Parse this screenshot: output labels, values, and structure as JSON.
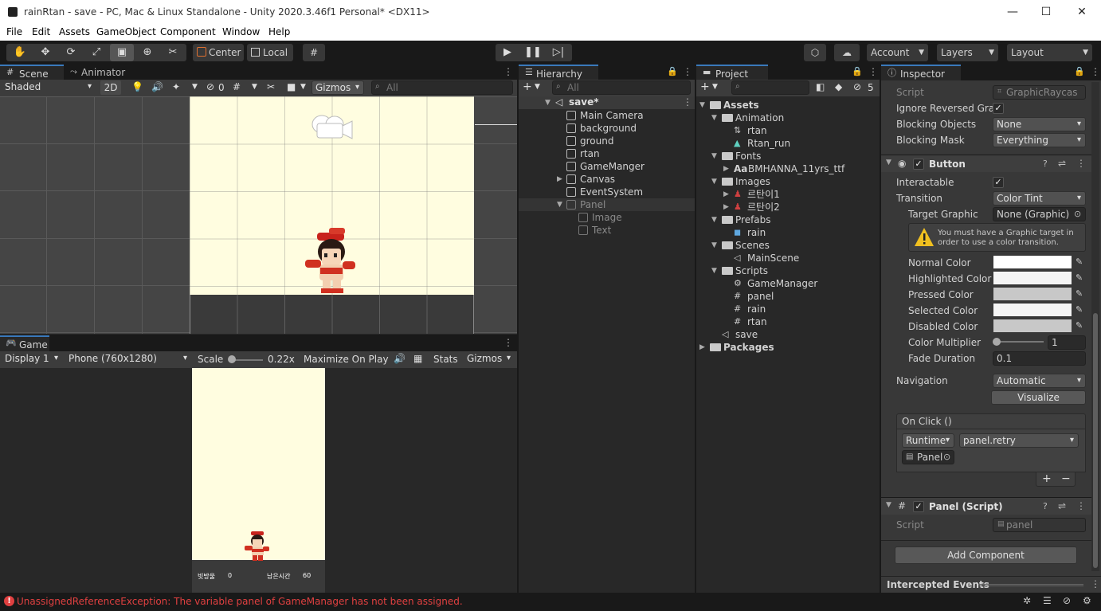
{
  "window": {
    "title": "rainRtan - save - PC, Mac & Linux Standalone - Unity 2020.3.46f1 Personal* <DX11>",
    "minimize": "—",
    "maximize": "☐",
    "close": "✕"
  },
  "menu": [
    "File",
    "Edit",
    "Assets",
    "GameObject",
    "Component",
    "Window",
    "Help"
  ],
  "toolbar": {
    "pivot": "Center",
    "space": "Local",
    "account": "Account",
    "layers": "Layers",
    "layout": "Layout"
  },
  "scene": {
    "tab": "Scene",
    "tab2": "Animator",
    "shading": "Shaded",
    "mode2d": "2D",
    "hidden_count": "0",
    "gizmos": "Gizmos",
    "search_placeholder": "All"
  },
  "game": {
    "tab": "Game",
    "display": "Display 1",
    "resolution": "Phone (760x1280)",
    "scale_label": "Scale",
    "scale_value": "0.22x",
    "maximize": "Maximize On Play",
    "stats": "Stats",
    "gizmos": "Gizmos",
    "hud_left_label": "빗방울",
    "hud_left_value": "0",
    "hud_right_label": "남은시간",
    "hud_right_value": "60"
  },
  "hierarchy": {
    "tab": "Hierarchy",
    "search_placeholder": "All",
    "scene": "save*",
    "items": [
      {
        "label": "Main Camera",
        "dim": false,
        "expander": ""
      },
      {
        "label": "background",
        "dim": false,
        "expander": ""
      },
      {
        "label": "ground",
        "dim": false,
        "expander": ""
      },
      {
        "label": "rtan",
        "dim": false,
        "expander": ""
      },
      {
        "label": "GameManger",
        "dim": false,
        "expander": ""
      },
      {
        "label": "Canvas",
        "dim": false,
        "expander": "▶"
      },
      {
        "label": "EventSystem",
        "dim": false,
        "expander": ""
      },
      {
        "label": "Panel",
        "dim": true,
        "expander": "▼"
      },
      {
        "label": "Image",
        "dim": true,
        "expander": ""
      },
      {
        "label": "Text",
        "dim": true,
        "expander": ""
      }
    ]
  },
  "project": {
    "tab": "Project",
    "hidden_count": "5",
    "tree": [
      {
        "label": "Assets",
        "level": 0,
        "folder": true,
        "bold": true
      },
      {
        "label": "Animation",
        "level": 1,
        "folder": true
      },
      {
        "label": "rtan",
        "level": 2,
        "folder": false,
        "icon": "anim"
      },
      {
        "label": "Rtan_run",
        "level": 2,
        "folder": false,
        "icon": "clip"
      },
      {
        "label": "Fonts",
        "level": 1,
        "folder": true
      },
      {
        "label": "BMHANNA_11yrs_ttf",
        "level": 2,
        "folder": false,
        "icon": "font",
        "prefix": "Aa"
      },
      {
        "label": "Images",
        "level": 1,
        "folder": true
      },
      {
        "label": "르탄이1",
        "level": 2,
        "folder": false,
        "icon": "sprite"
      },
      {
        "label": "르탄이2",
        "level": 2,
        "folder": false,
        "icon": "sprite"
      },
      {
        "label": "Prefabs",
        "level": 1,
        "folder": true
      },
      {
        "label": "rain",
        "level": 2,
        "folder": false,
        "icon": "prefab"
      },
      {
        "label": "Scenes",
        "level": 1,
        "folder": true
      },
      {
        "label": "MainScene",
        "level": 2,
        "folder": false,
        "icon": "scene"
      },
      {
        "label": "Scripts",
        "level": 1,
        "folder": true
      },
      {
        "label": "GameManager",
        "level": 2,
        "folder": false,
        "icon": "gear"
      },
      {
        "label": "panel",
        "level": 2,
        "folder": false,
        "icon": "script"
      },
      {
        "label": "rain",
        "level": 2,
        "folder": false,
        "icon": "script"
      },
      {
        "label": "rtan",
        "level": 2,
        "folder": false,
        "icon": "script"
      },
      {
        "label": "save",
        "level": 1,
        "folder": false,
        "icon": "scene"
      },
      {
        "label": "Packages",
        "level": 0,
        "folder": true,
        "bold": true
      }
    ]
  },
  "inspector": {
    "tab": "Inspector",
    "raycaster": {
      "script_label": "Script",
      "script_value": "GraphicRaycas",
      "ignore_label": "Ignore Reversed Grap",
      "blocking_objects_label": "Blocking Objects",
      "blocking_objects_value": "None",
      "blocking_mask_label": "Blocking Mask",
      "blocking_mask_value": "Everything"
    },
    "button": {
      "title": "Button",
      "interactable_label": "Interactable",
      "transition_label": "Transition",
      "transition_value": "Color Tint",
      "target_graphic_label": "Target Graphic",
      "target_graphic_value": "None (Graphic)",
      "warning": "You must have a Graphic target in order to use a color transition.",
      "colors": [
        {
          "label": "Normal Color",
          "value": "#ffffff"
        },
        {
          "label": "Highlighted Color",
          "value": "#f5f5f5"
        },
        {
          "label": "Pressed Color",
          "value": "#c8c8c8"
        },
        {
          "label": "Selected Color",
          "value": "#f5f5f5"
        },
        {
          "label": "Disabled Color",
          "value": "#c8c8c8"
        }
      ],
      "color_multiplier_label": "Color Multiplier",
      "color_multiplier_value": "1",
      "fade_duration_label": "Fade Duration",
      "fade_duration_value": "0.1",
      "navigation_label": "Navigation",
      "navigation_value": "Automatic",
      "visualize": "Visualize",
      "onclick_label": "On Click ()",
      "onclick_runtime": "Runtime",
      "onclick_function": "panel.retry",
      "onclick_target": "Panel",
      "plus": "+",
      "minus": "−"
    },
    "panel_script": {
      "title": "Panel (Script)",
      "script_label": "Script",
      "script_value": "panel"
    },
    "add_component": "Add Component",
    "intercepted": "Intercepted Events"
  },
  "status": {
    "message": "UnassignedReferenceException: The variable panel of GameManager has not been assigned.",
    "color": "#e04040"
  }
}
